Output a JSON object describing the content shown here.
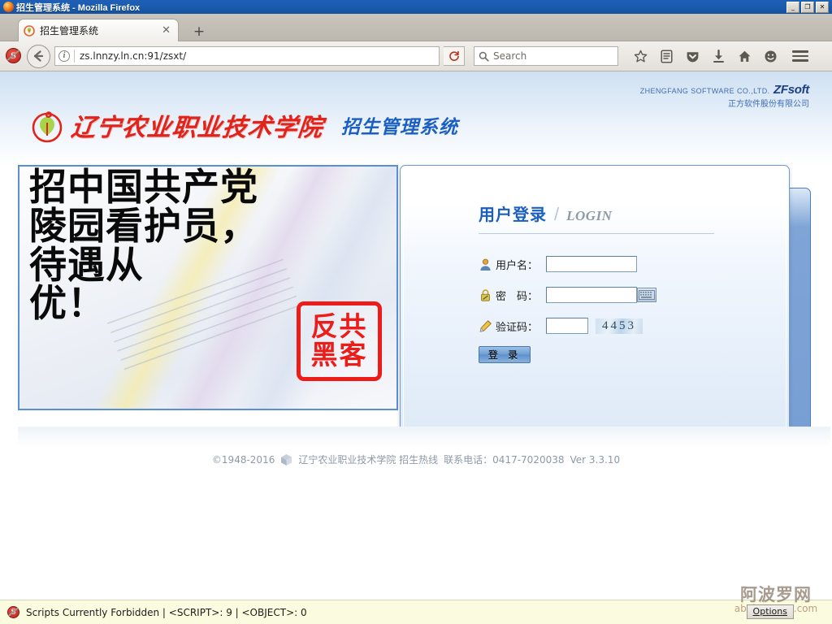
{
  "window": {
    "title": "招生管理系统 - Mozilla Firefox",
    "minimize_label": "_",
    "restore_label": "❐",
    "close_label": "✕"
  },
  "browser": {
    "tab": {
      "title": "招生管理系统",
      "close_label": "✕",
      "favicon": "school-flower-icon"
    },
    "new_tab_label": "+",
    "toolbar": {
      "noscript_icon": "noscript-s-icon",
      "back_icon": "back-arrow-icon",
      "identity_icon": "info-circle-icon",
      "url": "zs.lnnzy.ln.cn:91/zsxt/",
      "reload_icon": "reload-icon",
      "search_placeholder": "Search",
      "search_icon": "search-icon",
      "icons": [
        {
          "name": "bookmark-star-icon",
          "glyph": "☆"
        },
        {
          "name": "reader-list-icon",
          "glyph": "▤"
        },
        {
          "name": "pocket-shield-icon",
          "glyph": "▼"
        },
        {
          "name": "downloads-icon",
          "glyph": "⬇"
        },
        {
          "name": "home-icon",
          "glyph": "⌂"
        },
        {
          "name": "sync-smiley-icon",
          "glyph": "☺"
        }
      ],
      "menu_icon": "hamburger-menu-icon"
    }
  },
  "page": {
    "header": {
      "logo_icon": "school-flower-logo",
      "school_name": "辽宁农业职业技术学院",
      "system_name": "招生管理系统",
      "vendor_en": "ZHENGFANG SOFTWARE CO.,LTD.",
      "vendor_logo": "ZFsoft",
      "vendor_cn": "正方软件股份有限公司"
    },
    "banner": {
      "lines": [
        "招中国共产党",
        "陵园看护员，",
        "待遇从",
        "优！"
      ],
      "stamp_lines": [
        "反共",
        "黑客"
      ],
      "alt": "recruitment-banner-image"
    },
    "login": {
      "title_cn": "用户登录",
      "title_divider": "/",
      "title_en": "LOGIN",
      "fields": [
        {
          "icon": "user-icon",
          "label": "用户名：",
          "value": "",
          "placeholder": ""
        },
        {
          "icon": "lock-icon",
          "label": "密　码：",
          "value": "",
          "placeholder": ""
        },
        {
          "icon": "pencil-icon",
          "label": "验证码：",
          "value": "",
          "placeholder": ""
        }
      ],
      "keyboard_icon": "soft-keyboard-icon",
      "captcha_text": "4453",
      "submit_label": "登 录"
    },
    "footer": {
      "copyright": "©1948-2016",
      "cube_icon": "cube-icon",
      "org": "辽宁农业职业技术学院 招生热线",
      "contact": "联系电话：0417-7020038",
      "version": "Ver 3.3.10"
    }
  },
  "statusbar": {
    "noscript_icon": "noscript-s-icon",
    "text": "Scripts Currently Forbidden | <SCRIPT>: 9 | <OBJECT>: 0",
    "options_label": "Options"
  },
  "watermark": {
    "cn": "阿波罗网",
    "en": "aboluowang.com"
  },
  "colors": {
    "titlebar": "#1b5cb0",
    "accent_blue": "#1a5fbf",
    "school_red": "#e2231a",
    "status_bg": "#fbfbdf",
    "card_border": "#6f9ad2"
  }
}
